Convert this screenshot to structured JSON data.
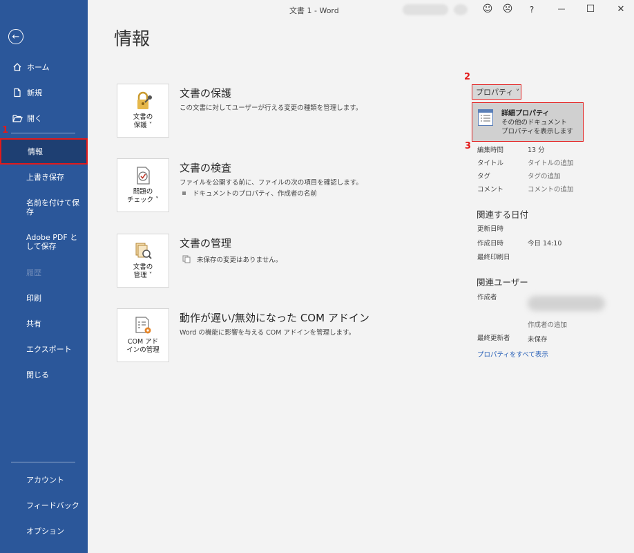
{
  "window": {
    "title": "文書 1  -  Word"
  },
  "titlebar_icons": [
    "smile-icon",
    "frown-icon",
    "help-icon",
    "minimize-icon",
    "maximize-icon",
    "close-icon"
  ],
  "titlebar_glyphs": {
    "smile": "☺",
    "frown": "☹",
    "help": "?",
    "minimize": "—",
    "maximize": "☐",
    "close": "✕"
  },
  "sidebar": {
    "back_glyph": "←",
    "top_items": [
      {
        "label": "ホーム",
        "icon": "home-icon"
      },
      {
        "label": "新規",
        "icon": "new-document-icon"
      },
      {
        "label": "開く",
        "icon": "open-folder-icon"
      }
    ],
    "items": [
      {
        "label": "情報",
        "selected": true
      },
      {
        "label": "上書き保存"
      },
      {
        "label": "名前を付けて保存"
      },
      {
        "label": "Adobe PDF として保存"
      },
      {
        "label": "履歴",
        "disabled": true
      },
      {
        "label": "印刷"
      },
      {
        "label": "共有"
      },
      {
        "label": "エクスポート"
      },
      {
        "label": "閉じる"
      }
    ],
    "bottom_items": [
      {
        "label": "アカウント"
      },
      {
        "label": "フィードバック"
      },
      {
        "label": "オプション"
      }
    ]
  },
  "annotations": {
    "step1": "1",
    "step2": "2",
    "step3": "3"
  },
  "main": {
    "title": "情報",
    "sections": [
      {
        "card_label": "文書の\n保護 ˅",
        "title": "文書の保護",
        "desc": "この文書に対してユーザーが行える変更の種類を管理します。",
        "icon": "lock-key-icon"
      },
      {
        "card_label": "問題の\nチェック ˅",
        "title": "文書の検査",
        "desc": "ファイルを公開する前に、ファイルの次の項目を確認します。",
        "sub": "ドキュメントのプロパティ、作成者の名前",
        "icon": "inspect-icon"
      },
      {
        "card_label": "文書の\n管理 ˅",
        "title": "文書の管理",
        "desc": "",
        "sub": "未保存の変更はありません。",
        "icon": "manage-document-icon"
      },
      {
        "card_label": "COM アド\nインの管理",
        "title": "動作が遅い/無効になった COM アドイン",
        "desc": "Word の機能に影響を与える COM アドインを管理します。",
        "icon": "com-addin-icon"
      }
    ]
  },
  "properties": {
    "button_label": "プロパティ ˅",
    "menu": {
      "title": "詳細プロパティ",
      "desc": "その他のドキュメント\nプロパティを表示します"
    },
    "rows": [
      {
        "label": "編集時間",
        "value": "13 分"
      },
      {
        "label": "タイトル",
        "value": "タイトルの追加"
      },
      {
        "label": "タグ",
        "value": "タグの追加"
      },
      {
        "label": "コメント",
        "value": "コメントの追加"
      }
    ],
    "dates_heading": "関連する日付",
    "dates": [
      {
        "label": "更新日時",
        "value": ""
      },
      {
        "label": "作成日時",
        "value": "今日 14:10"
      },
      {
        "label": "最終印刷日",
        "value": ""
      }
    ],
    "users_heading": "関連ユーザー",
    "author_label": "作成者",
    "add_author": "作成者の追加",
    "last_modified_label": "最終更新者",
    "last_modified_value": "未保存",
    "show_all": "プロパティをすべて表示"
  },
  "colors": {
    "sidebar": "#2b579a",
    "selected": "#1e3f72",
    "annotation": "#e21a1a",
    "link": "#2b62b8"
  }
}
